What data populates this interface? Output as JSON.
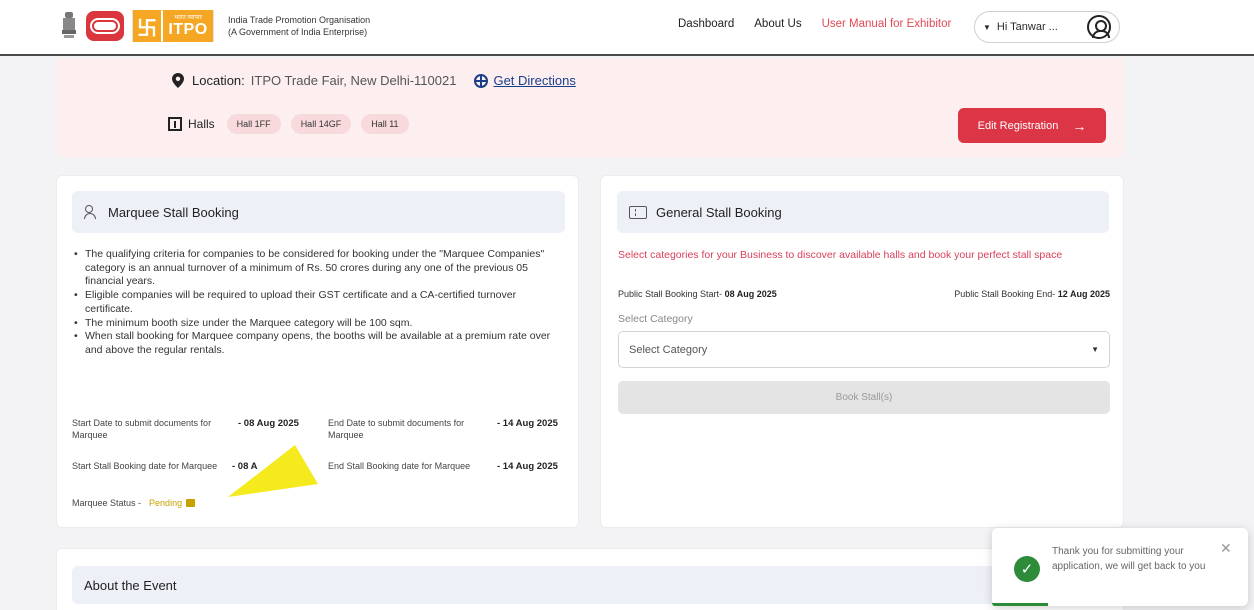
{
  "header": {
    "org_name_line1": "India Trade Promotion Organisation",
    "org_name_line2": "(A Government of India Enterprise)",
    "logo_small_text": "भारत व्यापार",
    "logo_text": "ITPO",
    "nav": {
      "dashboard": "Dashboard",
      "about": "About Us",
      "manual": "User Manual for Exhibitor"
    },
    "user_name": "Hi Tanwar ..."
  },
  "event": {
    "location_label": "Location:",
    "location_value": "ITPO Trade Fair, New Delhi-110021",
    "directions": "Get Directions",
    "halls_label": "Halls",
    "halls": [
      "Hall 1FF",
      "Hall 14GF",
      "Hall 11"
    ],
    "edit_button": "Edit Registration"
  },
  "marquee": {
    "title": "Marquee Stall Booking",
    "criteria": [
      "The qualifying criteria for companies to be considered for booking under the \"Marquee Companies\" category is an annual turnover of a minimum of Rs. 50 crores during any one of the previous 05 financial years.",
      "Eligible companies will be required to upload their GST certificate and a CA-certified turnover certificate.",
      "The minimum booth size under the Marquee category will be 100 sqm.",
      "When stall booking for Marquee company opens, the booths will be available at a premium rate over and above the regular rentals."
    ],
    "start_doc_label": "Start Date to submit documents for Marquee",
    "start_doc_value": "- 08 Aug 2025",
    "end_doc_label": "End Date to submit documents for Marquee",
    "end_doc_value": "- 14 Aug 2025",
    "start_booking_label": "Start Stall Booking date for Marquee",
    "start_booking_value": "- 08 A",
    "end_booking_label": "End Stall Booking date for Marquee",
    "end_booking_value": "- 14 Aug 2025",
    "status_label": "Marquee Status -",
    "status_value": "Pending"
  },
  "general": {
    "title": "General Stall Booking",
    "description": "Select categories for your Business to discover available halls and book your perfect stall space",
    "start_label": "Public Stall Booking Start-",
    "start_value": "08 Aug 2025",
    "end_label": "Public Stall Booking End-",
    "end_value": "12 Aug 2025",
    "category_label": "Select Category",
    "category_placeholder": "Select Category",
    "book_button": "Book Stall(s)"
  },
  "about": {
    "title": "About the Event"
  },
  "toast": {
    "message": "Thank you for submitting your application, we will get back to you"
  },
  "colors": {
    "accent": "#dc3545",
    "pink_bg": "#fdeff0",
    "success": "#2e8b3a",
    "pending": "#c8a100",
    "pointer_yellow": "#f5ea1e"
  }
}
